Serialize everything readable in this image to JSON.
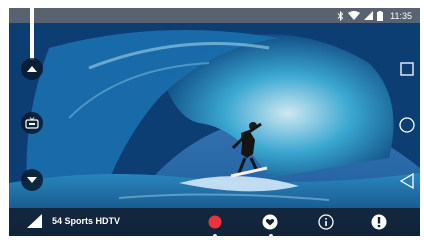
{
  "status_bar": {
    "icons": [
      "bluetooth-icon",
      "wifi-icon",
      "cell-signal-icon",
      "battery-icon"
    ],
    "time": "11:35"
  },
  "side_controls": [
    "channel-up-icon",
    "tv-guide-icon",
    "channel-down-icon"
  ],
  "nav_buttons": [
    "recents-square-icon",
    "home-circle-icon",
    "back-triangle-icon"
  ],
  "bottom_bar": {
    "channel_name": "54 Sports HDTV",
    "buttons": [
      "record-icon",
      "favorite-heart-icon",
      "info-icon",
      "alert-icon"
    ]
  },
  "colors": {
    "record": "#e8323c",
    "status_bar": "#6e6e6e",
    "bottom_bar": "#122032"
  }
}
